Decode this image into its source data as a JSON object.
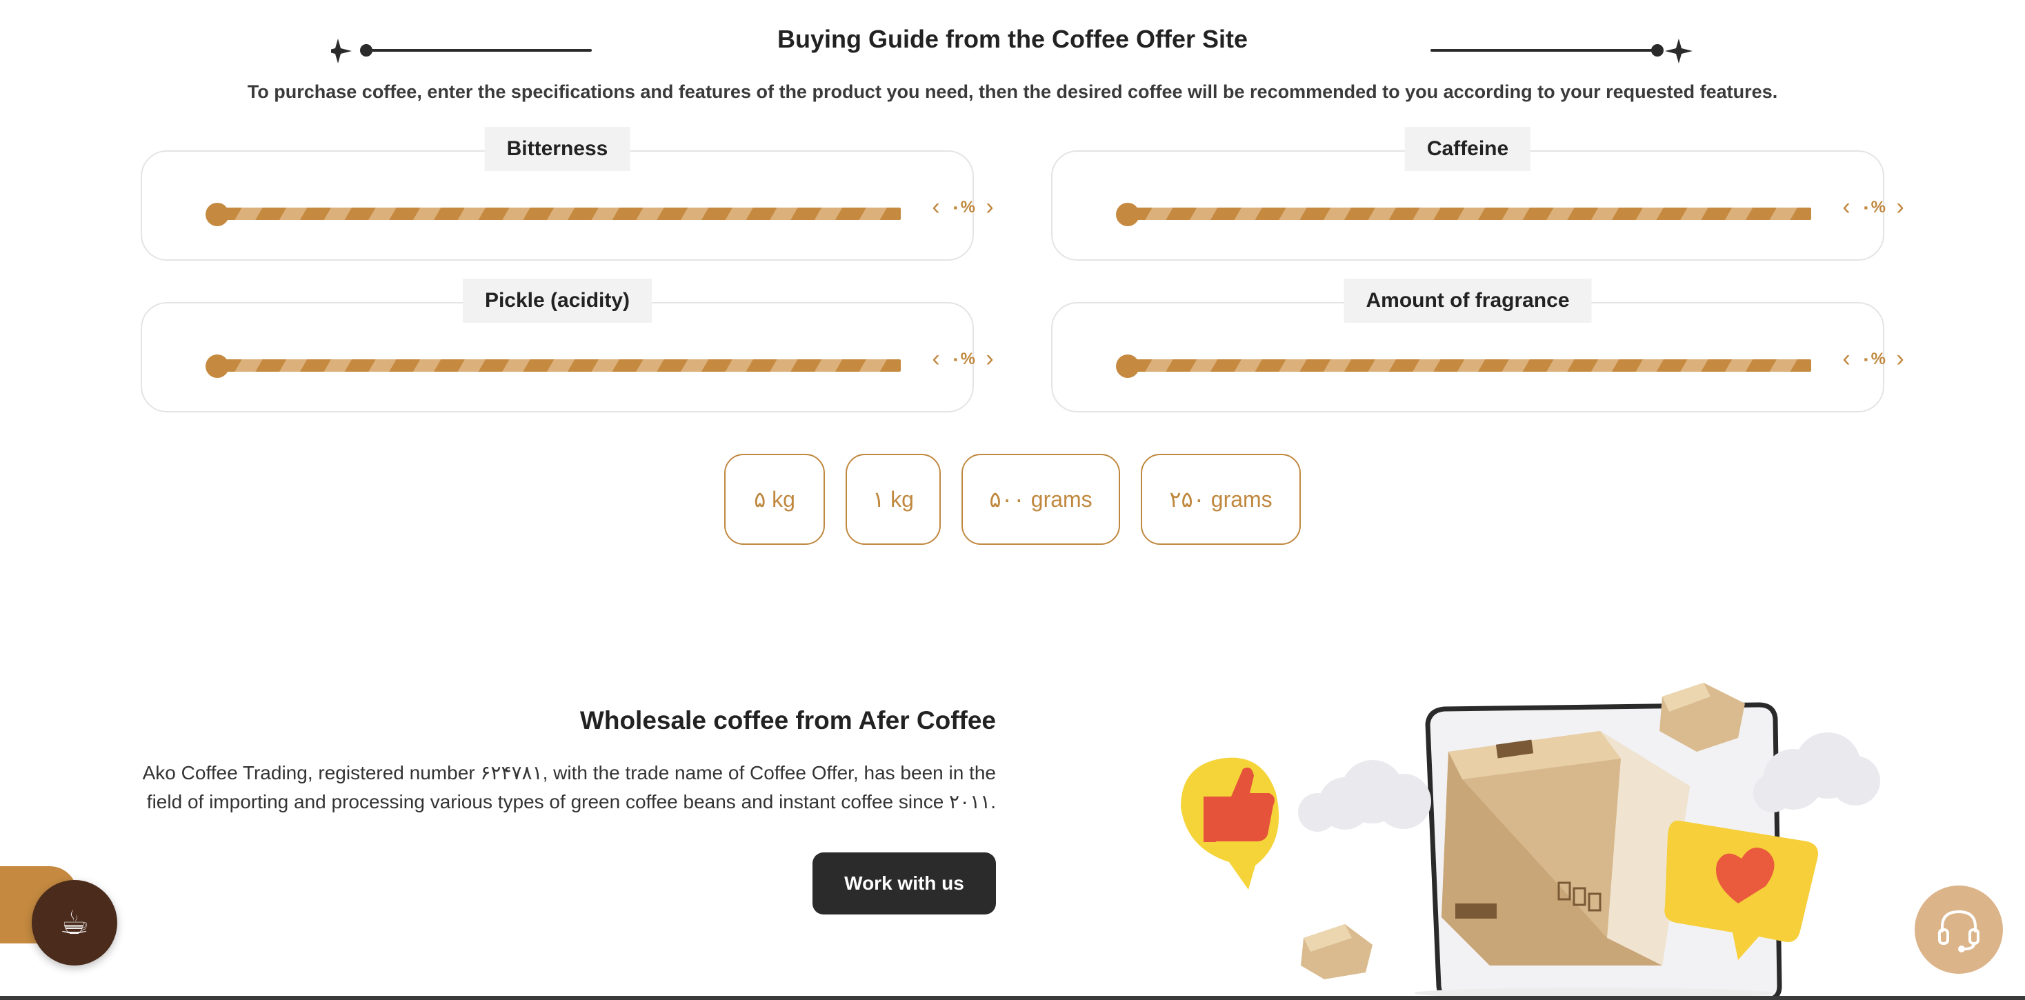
{
  "guide": {
    "title": "Buying Guide from the Coffee Offer Site",
    "subtitle": "To purchase coffee, enter the specifications and features of the product you need, then the desired coffee will be recommended to you according to your requested features."
  },
  "sliders": [
    {
      "label": "Bitterness",
      "value_text": "٠%",
      "value": 0
    },
    {
      "label": "Caffeine",
      "value_text": "٠%",
      "value": 0
    },
    {
      "label": "Pickle (acidity)",
      "value_text": "٠%",
      "value": 0
    },
    {
      "label": "Amount of fragrance",
      "value_text": "٠%",
      "value": 0
    }
  ],
  "weights": [
    "۵ kg",
    "۱ kg",
    "۵٠٠ grams",
    "۲۵٠ grams"
  ],
  "wholesale": {
    "title": "Wholesale coffee from Afer Coffee",
    "body": "Ako Coffee Trading, registered number ۶۲۴۷۸۱, with the trade name of Coffee Offer, has been in the field of importing and processing various types of green coffee beans and instant coffee since ۲٠۱۱.",
    "button": "Work with us"
  },
  "icons": {
    "chevron_left": "chevron-left-icon",
    "chevron_right": "chevron-right-icon",
    "coffee": "coffee-cup-icon",
    "support": "headset-icon"
  },
  "colors": {
    "accent": "#c58a40",
    "dark": "#2b2b2b",
    "coffee_fab": "#4a2b1c",
    "support_fab": "#dcb48a"
  }
}
